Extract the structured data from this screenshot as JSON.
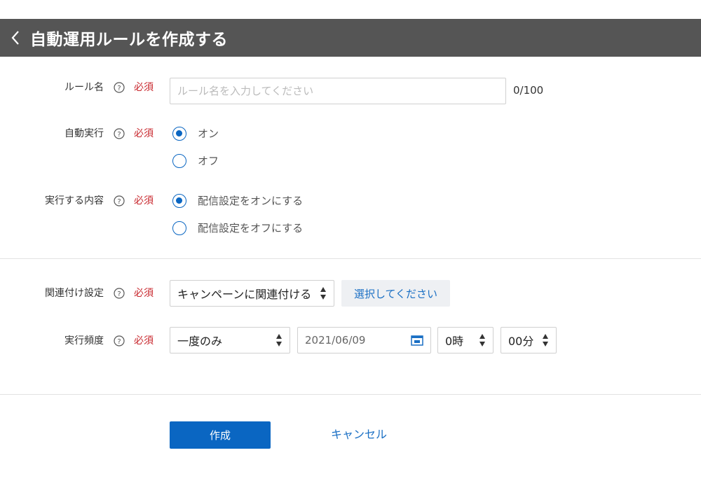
{
  "header": {
    "title": "自動運用ルールを作成する"
  },
  "form": {
    "rule_name": {
      "label": "ルール名",
      "required": "必須",
      "placeholder": "ルール名を入力してください",
      "value": "",
      "counter": "0/100"
    },
    "auto_run": {
      "label": "自動実行",
      "required": "必須",
      "options": [
        {
          "label": "オン",
          "checked": true
        },
        {
          "label": "オフ",
          "checked": false
        }
      ]
    },
    "action": {
      "label": "実行する内容",
      "required": "必須",
      "options": [
        {
          "label": "配信設定をオンにする",
          "checked": true
        },
        {
          "label": "配信設定をオフにする",
          "checked": false
        }
      ]
    },
    "association": {
      "label": "関連付け設定",
      "required": "必須",
      "selected": "キャンペーンに関連付ける",
      "select_button": "選択してください"
    },
    "frequency": {
      "label": "実行頻度",
      "required": "必須",
      "selected": "一度のみ",
      "date": "2021/06/09",
      "hour": "0時",
      "minute": "00分"
    }
  },
  "actions": {
    "create": "作成",
    "cancel": "キャンセル"
  },
  "colors": {
    "header_bg": "#555555",
    "accent": "#0a66c2",
    "required": "#c8272d",
    "link": "#1a6fc4"
  }
}
